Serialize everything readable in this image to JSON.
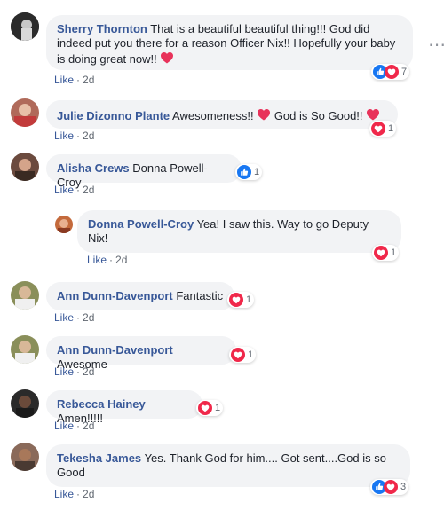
{
  "comments": [
    {
      "author": "Sherry Thornton",
      "text": "That is a beautiful beautiful thing!!! God did indeed put you there for a reason Officer Nix!! Hopefully your baby is doing great now!!",
      "like_label": "Like",
      "time": "2d",
      "reactions": [
        "like",
        "love"
      ],
      "count": "7"
    },
    {
      "author": "Julie Dizonno Plante",
      "text_before": "Awesomeness!!",
      "text_after": "God is So Good!!",
      "like_label": "Like",
      "time": "2d",
      "reactions": [
        "love"
      ],
      "count": "1"
    },
    {
      "author": "Alisha Crews",
      "text": "Donna Powell-Croy",
      "like_label": "Like",
      "time": "2d",
      "reactions": [
        "like"
      ],
      "count": "1"
    },
    {
      "author": "Donna Powell-Croy",
      "text": "Yea! I saw this. Way to go Deputy Nix!",
      "like_label": "Like",
      "time": "2d",
      "reactions": [
        "love"
      ],
      "count": "1",
      "reply": true
    },
    {
      "author": "Ann Dunn-Davenport",
      "text": "Fantastic",
      "like_label": "Like",
      "time": "2d",
      "reactions": [
        "love"
      ],
      "count": "1"
    },
    {
      "author": "Ann Dunn-Davenport",
      "text": "Awesome",
      "like_label": "Like",
      "time": "2d",
      "reactions": [
        "love"
      ],
      "count": "1"
    },
    {
      "author": "Rebecca Hainey",
      "text": "Amen!!!!!",
      "like_label": "Like",
      "time": "2d",
      "reactions": [
        "love"
      ],
      "count": "1"
    },
    {
      "author": "Tekesha James",
      "text": "Yes. Thank God for him.... Got sent....God is so Good",
      "like_label": "Like",
      "time": "2d",
      "reactions": [
        "like",
        "love"
      ],
      "count": "3"
    }
  ],
  "colors": {
    "link": "#385898",
    "like_blue": "#1877f2",
    "love_red": "#f0284a",
    "bubble_bg": "#f2f3f5"
  },
  "icons": [
    "more-options-icon",
    "like-reaction-icon",
    "love-reaction-icon",
    "heart-emoji-icon"
  ]
}
